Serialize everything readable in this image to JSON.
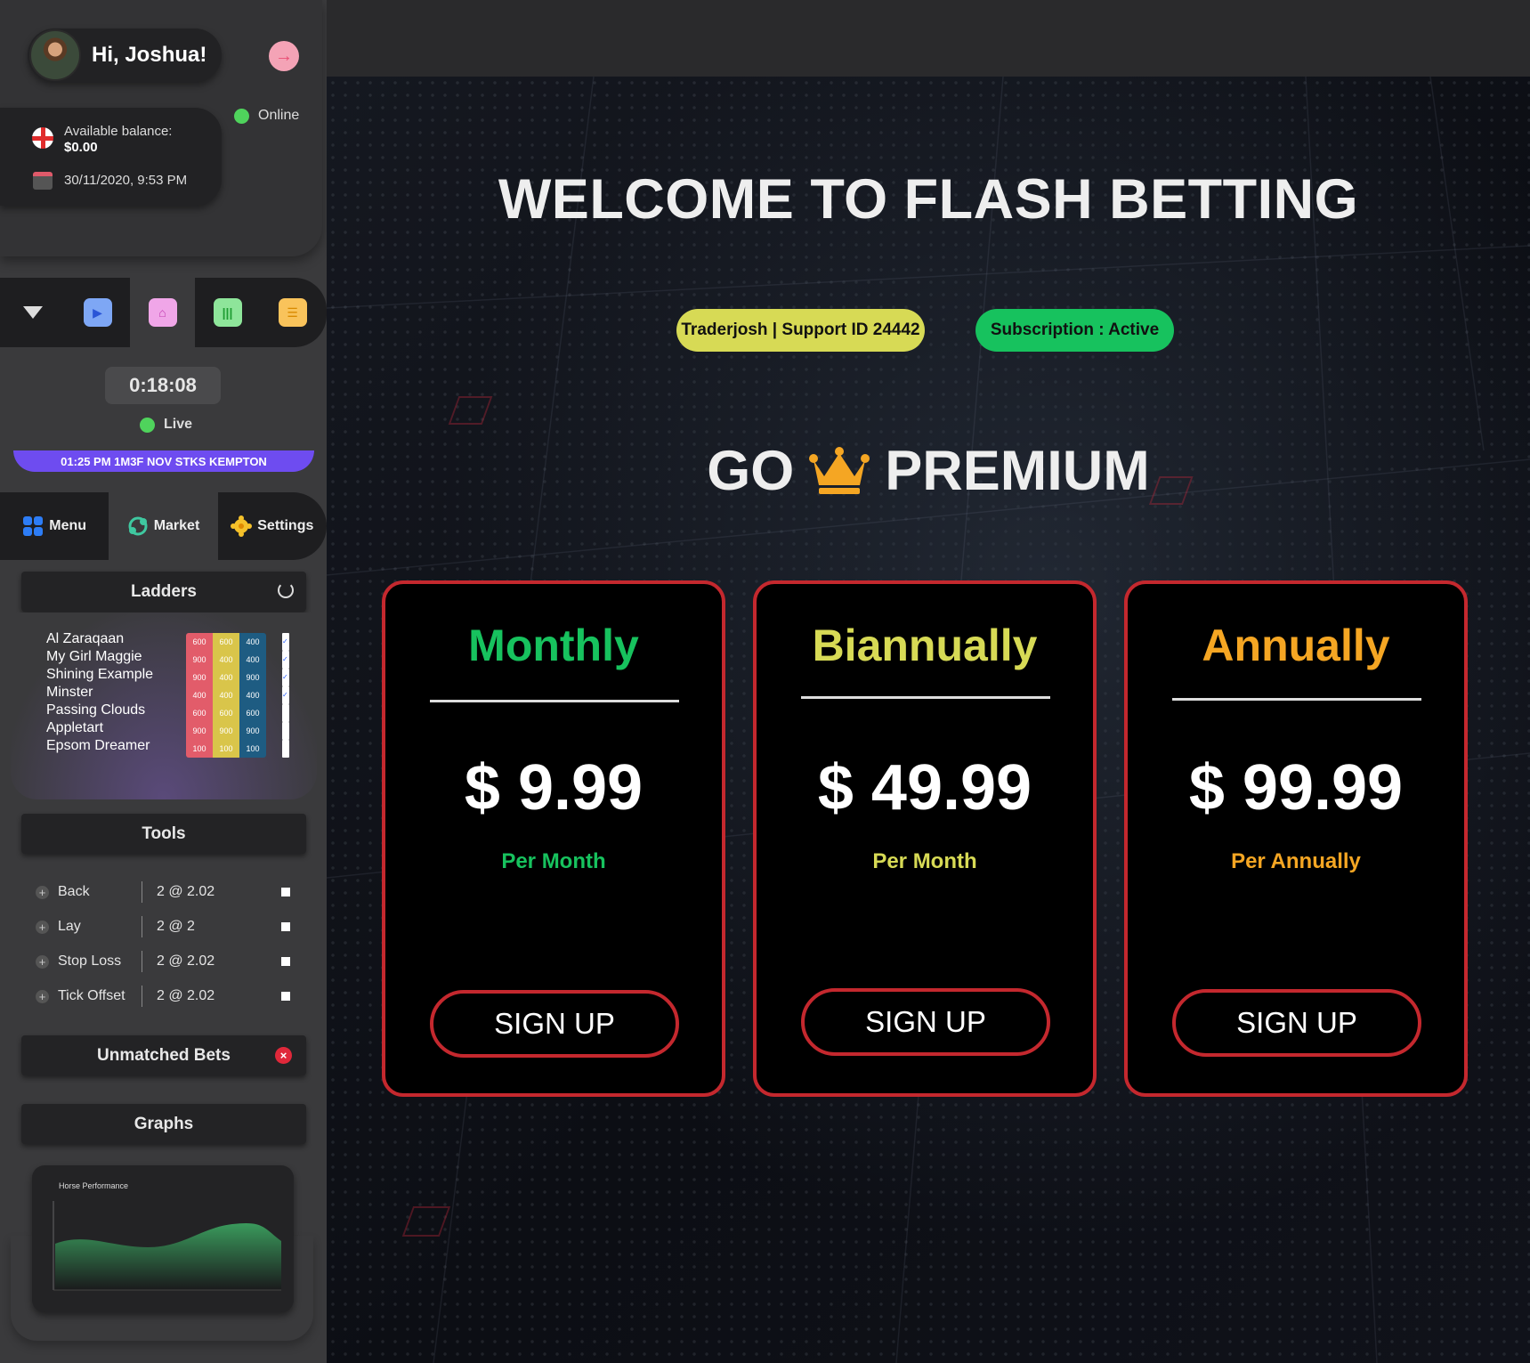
{
  "sidebar": {
    "greeting": "Hi, Joshua!",
    "status": "Online",
    "balance_label": "Available balance:",
    "balance_value": "$0.00",
    "datetime": "30/11/2020, 9:53 PM",
    "timer": "0:18:08",
    "live_label": "Live",
    "race": "01:25 PM 1M3F NOV STKS KEMPTON",
    "nav_tabs": [
      {
        "label": "Menu",
        "icon": "grid-icon"
      },
      {
        "label": "Market",
        "icon": "market-icon"
      },
      {
        "label": "Settings",
        "icon": "gear-icon"
      }
    ],
    "ladders_title": "Ladders",
    "ladders": [
      {
        "name": "Al Zaraqaan",
        "v1": "600",
        "v2": "600",
        "v3": "400",
        "checked": true
      },
      {
        "name": "My Girl Maggie",
        "v1": "900",
        "v2": "400",
        "v3": "400",
        "checked": true
      },
      {
        "name": "Shining Example",
        "v1": "900",
        "v2": "400",
        "v3": "900",
        "checked": true
      },
      {
        "name": "Minster",
        "v1": "400",
        "v2": "400",
        "v3": "400",
        "checked": true
      },
      {
        "name": "Passing Clouds",
        "v1": "600",
        "v2": "600",
        "v3": "600",
        "checked": false
      },
      {
        "name": "Appletart",
        "v1": "900",
        "v2": "900",
        "v3": "900",
        "checked": false
      },
      {
        "name": "Epsom Dreamer",
        "v1": "100",
        "v2": "100",
        "v3": "100",
        "checked": false
      }
    ],
    "tools_title": "Tools",
    "tools": [
      {
        "name": "Back",
        "value": "2 @ 2.02"
      },
      {
        "name": "Lay",
        "value": "2 @ 2"
      },
      {
        "name": "Stop Loss",
        "value": "2 @ 2.02"
      },
      {
        "name": "Tick Offset",
        "value": "2 @ 2.02"
      }
    ],
    "unmatched_title": "Unmatched Bets",
    "graphs_title": "Graphs",
    "graph_label": "Horse Performance"
  },
  "main": {
    "welcome": "WELCOME TO FLASH BETTING",
    "support_pill": "Traderjosh | Support ID 24442",
    "subscription_pill": "Subscription : Active",
    "go": "GO",
    "premium": "PREMIUM",
    "plans": [
      {
        "title": "Monthly",
        "price": "$ 9.99",
        "period": "Per Month",
        "color": "#17c25e",
        "button": "SIGN UP"
      },
      {
        "title": "Biannually",
        "price": "$ 49.99",
        "period": "Per Month",
        "color": "#d7da55",
        "button": "SIGN UP"
      },
      {
        "title": "Annually",
        "price": "$ 99.99",
        "period": "Per Annually",
        "color": "#f5a623",
        "button": "SIGN UP"
      }
    ]
  },
  "colors": {
    "accent_red": "#c4282e",
    "live_green": "#4fd35c",
    "race_purple": "#6e4cf0"
  }
}
